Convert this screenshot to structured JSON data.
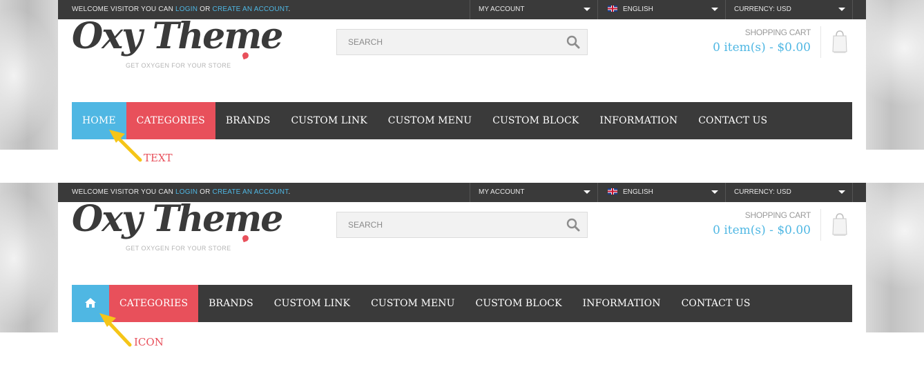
{
  "topbar": {
    "welcome_prefix": "WELCOME VISITOR YOU CAN",
    "login": "LOGIN",
    "or": "OR",
    "create_account": "CREATE AN ACCOUNT",
    "period": ".",
    "my_account": "MY ACCOUNT",
    "language": "ENGLISH",
    "currency": "CURRENCY: USD"
  },
  "logo": {
    "text": "Oxy Theme",
    "tagline": "GET OXYGEN FOR YOUR STORE"
  },
  "search": {
    "placeholder": "SEARCH",
    "icon": "search-icon"
  },
  "cart": {
    "label": "SHOPPING CART",
    "total": "0 item(s) - $0.00",
    "icon": "shopping-bag-icon"
  },
  "nav": {
    "home_label": "HOME",
    "home_icon": "home-icon",
    "items": [
      "CATEGORIES",
      "BRANDS",
      "CUSTOM LINK",
      "CUSTOM MENU",
      "CUSTOM BLOCK",
      "INFORMATION",
      "CONTACT US"
    ]
  },
  "annotations": {
    "text": "TEXT",
    "icon": "ICON"
  },
  "colors": {
    "accent_blue": "#4fb7e3",
    "accent_red": "#e8505b",
    "dark_bar": "#3a3a3a",
    "arrow": "#f5c518"
  }
}
